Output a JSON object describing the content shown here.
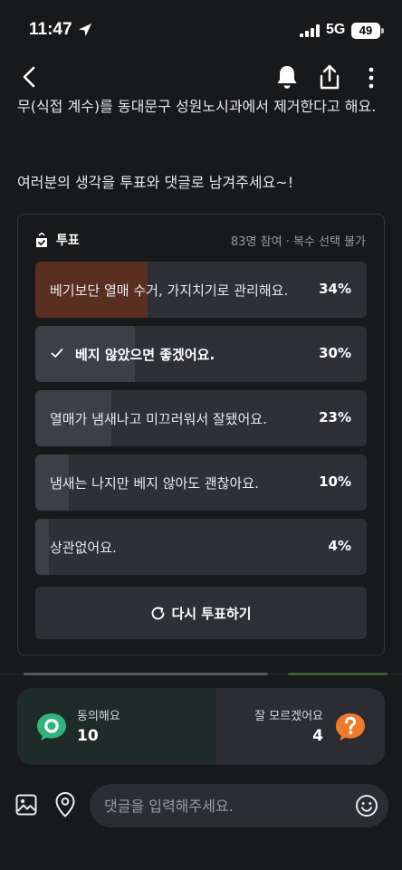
{
  "status_bar": {
    "time": "11:47",
    "network": "5G",
    "battery": "49"
  },
  "nav": {
    "icons": [
      "back-icon",
      "bell-icon",
      "share-icon",
      "more-icon"
    ]
  },
  "post": {
    "paragraph_1": "무(식접 계수)를 동대문구 성원노시과에서 제거한다고 해요.",
    "paragraph_2": "여러분의 생각을 투표와 댓글로 남겨주세요~!"
  },
  "poll": {
    "title": "투표",
    "meta": "83명 참여 · 복수 선택 불가",
    "options": [
      {
        "label": "베기보단 열매 수거, 가지치기로 관리해요.",
        "percent_text": "34%",
        "percent": 34,
        "leading": true,
        "selected": false
      },
      {
        "label": "베지 않았으면 좋겠어요.",
        "percent_text": "30%",
        "percent": 30,
        "leading": false,
        "selected": true
      },
      {
        "label": "열매가 냄새나고 미끄러워서 잘됐어요.",
        "percent_text": "23%",
        "percent": 23,
        "leading": false,
        "selected": false
      },
      {
        "label": "냄새는 나지만 베지 않아도 괜찮아요.",
        "percent_text": "10%",
        "percent": 10,
        "leading": false,
        "selected": false
      },
      {
        "label": "상관없어요.",
        "percent_text": "4%",
        "percent": 4,
        "leading": false,
        "selected": false
      }
    ],
    "revote_label": "다시 투표하기"
  },
  "reactions": {
    "agree": {
      "label": "동의해요",
      "count": "10"
    },
    "unsure": {
      "label": "잘 모르겠어요",
      "count": "4"
    }
  },
  "comment": {
    "placeholder": "댓글을 입력해주세요."
  },
  "colors": {
    "background": "#18191b",
    "option_bg": "#2e3036",
    "leading_fill": "#5a2f22",
    "agree_green": "#2fb47a",
    "unsure_orange": "#f07a2a"
  }
}
